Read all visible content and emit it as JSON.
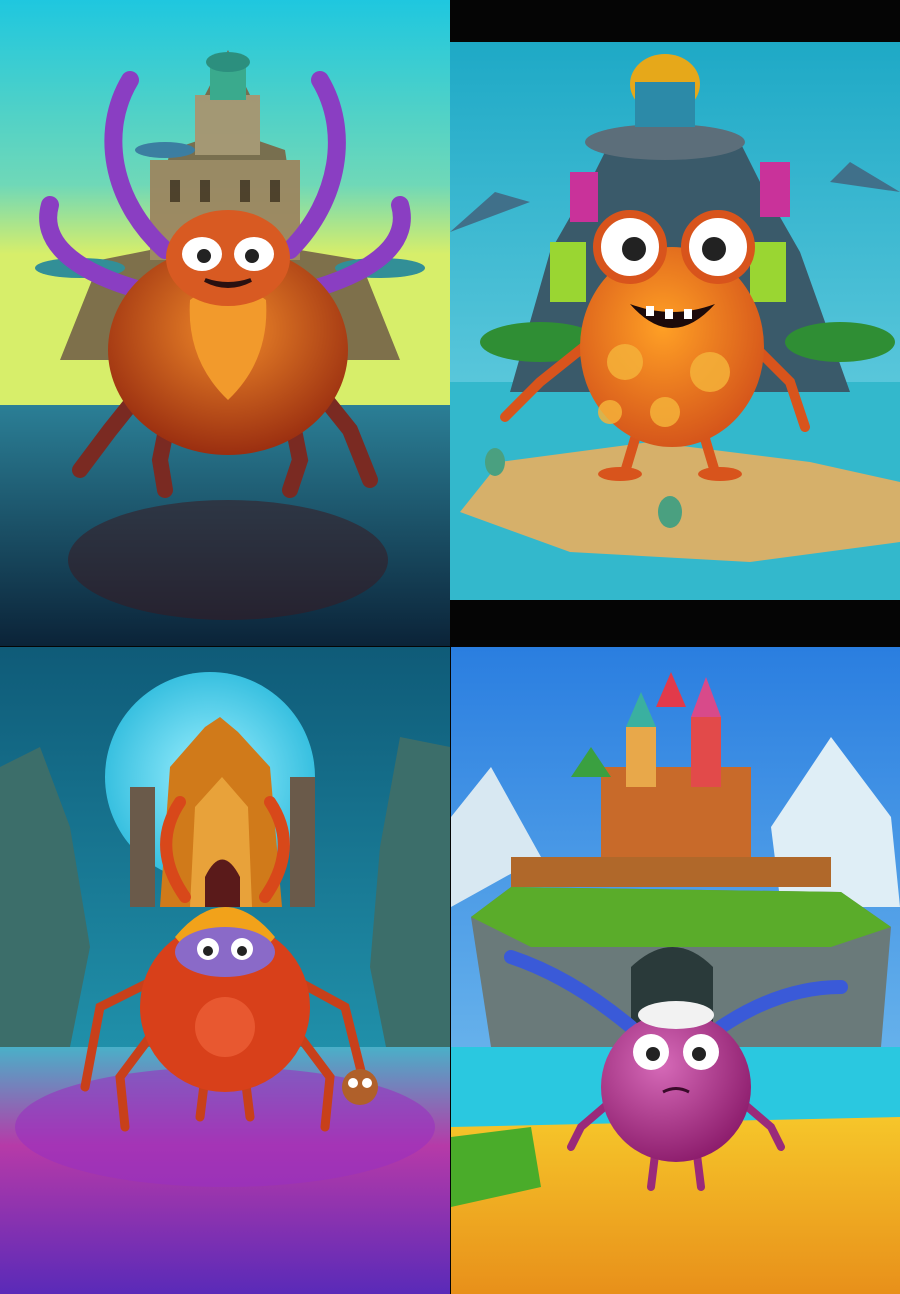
{
  "grid": {
    "background": "#050505",
    "panels": [
      {
        "id": "panel-1",
        "subject": "orange-crab-monster",
        "scene": "castle-island-over-water"
      },
      {
        "id": "panel-2",
        "subject": "orange-frog-monster",
        "scene": "colorful-tower-on-sandbar"
      },
      {
        "id": "panel-3",
        "subject": "red-horned-spider-monster",
        "scene": "gothic-castle-purple-ground"
      },
      {
        "id": "panel-4",
        "subject": "purple-ball-monster",
        "scene": "fairytale-castle-on-cliff"
      }
    ]
  },
  "colors": {
    "sky_teal": "#2ad0e0",
    "sky_blue": "#3a8ee8",
    "orange": "#e2561e",
    "purple": "#8a3ec2",
    "sand": "#d6b06a",
    "yellow_ground": "#f2b21e"
  }
}
